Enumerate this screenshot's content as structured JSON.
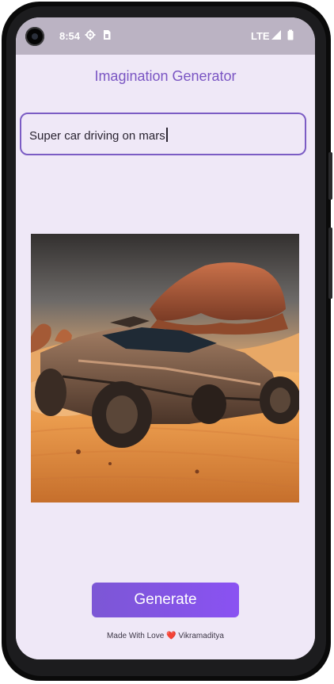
{
  "status_bar": {
    "time": "8:54",
    "network": "LTE",
    "icons": [
      "settings-gear-icon",
      "sim-card-icon",
      "signal-icon",
      "battery-icon"
    ]
  },
  "app": {
    "title": "Imagination Generator",
    "prompt_value": "Super car driving on mars",
    "image_alt": "Generated image of a rugged super car driving on the sandy surface of Mars",
    "generate_label": "Generate",
    "footer_prefix": "Made With Love",
    "footer_heart": "❤️",
    "footer_author": "Vikramaditya"
  },
  "colors": {
    "accent": "#7b5cc4",
    "button": "#8452e8",
    "background": "#efe8f7",
    "status_bar": "#bbb3c3"
  }
}
